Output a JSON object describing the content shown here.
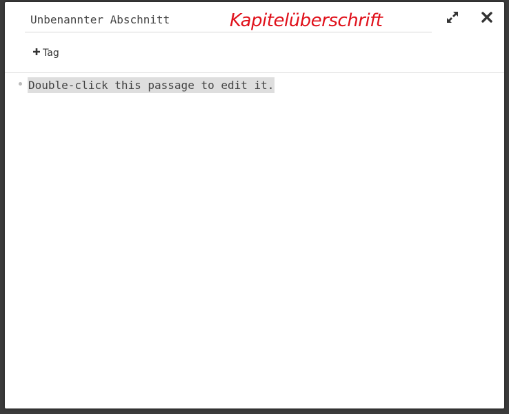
{
  "dialog": {
    "title_value": "Unbenannter Abschnitt",
    "annotation": "Kapitelüberschrift",
    "annotation_color": "#e0111b",
    "expand_icon": "expand-arrows-icon",
    "close_icon": "close-x-icon"
  },
  "tags": {
    "add_label": "Tag",
    "add_icon": "plus-icon"
  },
  "editor": {
    "passage_text": "Double-click this passage to edit it."
  }
}
